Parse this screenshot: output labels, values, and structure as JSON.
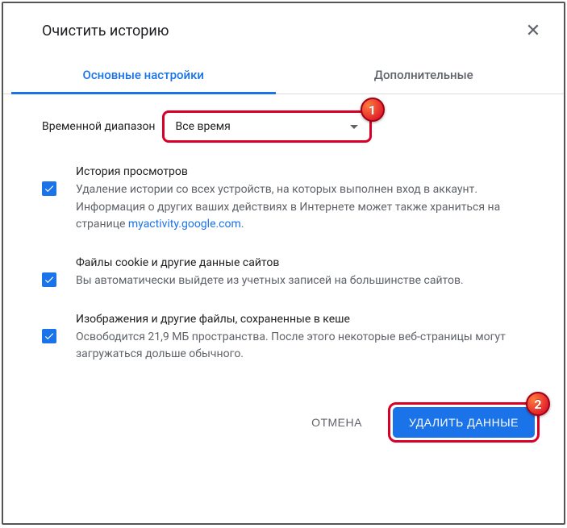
{
  "header": {
    "title": "Очистить историю"
  },
  "tabs": [
    {
      "label": "Основные настройки",
      "active": true
    },
    {
      "label": "Дополнительные",
      "active": false
    }
  ],
  "time_range": {
    "label": "Временной диапазон",
    "value": "Все время"
  },
  "options": [
    {
      "title": "История просмотров",
      "desc_before": "Удаление истории со всех устройств, на которых выполнен вход в аккаунт. Информация о других ваших действиях в Интернете может также храниться на странице ",
      "link_text": "myactivity.google.com",
      "desc_after": ".",
      "checked": true
    },
    {
      "title": "Файлы cookie и другие данные сайтов",
      "desc": "Вы автоматически выйдете из учетных записей на большинстве сайтов.",
      "checked": true
    },
    {
      "title": "Изображения и другие файлы, сохраненные в кеше",
      "desc": "Освободится 21,9 МБ пространства. После этого некоторые веб-страницы могут загружаться дольше обычного.",
      "checked": true
    }
  ],
  "footer": {
    "cancel": "ОТМЕНА",
    "clear": "УДАЛИТЬ ДАННЫЕ"
  },
  "annotations": [
    "1",
    "2"
  ],
  "colors": {
    "accent": "#1a73e8",
    "highlight": "#d80027",
    "text_primary": "#202124",
    "text_secondary": "#5f6368"
  }
}
